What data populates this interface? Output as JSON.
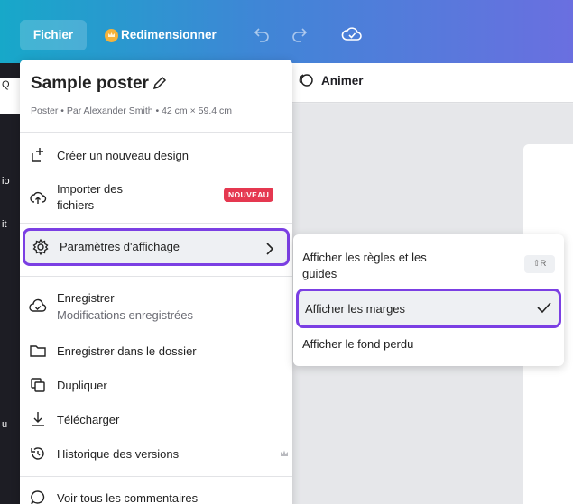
{
  "topbar": {
    "file_label": "Fichier",
    "resize_label": "Redimensionner"
  },
  "left_strip": {
    "fragments": [
      "Q",
      "io",
      "it",
      "u"
    ]
  },
  "toolbar2": {
    "animer_label": "Animer"
  },
  "menu": {
    "title": "Sample poster",
    "meta": "Poster • Par Alexander Smith • 42 cm × 59.4 cm",
    "items": [
      {
        "label": "Créer un nouveau design"
      },
      {
        "label": "Importer des fichiers",
        "label_line1": "Importer des",
        "label_line2": "fichiers",
        "badge": "NOUVEAU"
      },
      {
        "label": "Paramètres d'affichage"
      },
      {
        "label": "Enregistrer",
        "sub": "Modifications enregistrées"
      },
      {
        "label": "Enregistrer dans le dossier"
      },
      {
        "label": "Dupliquer"
      },
      {
        "label": "Télécharger"
      },
      {
        "label": "Historique des versions"
      },
      {
        "label": "Voir tous les commentaires"
      }
    ]
  },
  "submenu": {
    "items": [
      {
        "label_line1": "Afficher les règles et les",
        "label_line2": "guides",
        "shortcut": "⇧R"
      },
      {
        "label": "Afficher les marges",
        "checked": true
      },
      {
        "label": "Afficher le fond perdu"
      }
    ]
  },
  "colors": {
    "accent_purple": "#7b3fe3",
    "badge_red": "#e53850",
    "topbar_start": "#17a8c9",
    "topbar_end": "#6a6fe0"
  }
}
